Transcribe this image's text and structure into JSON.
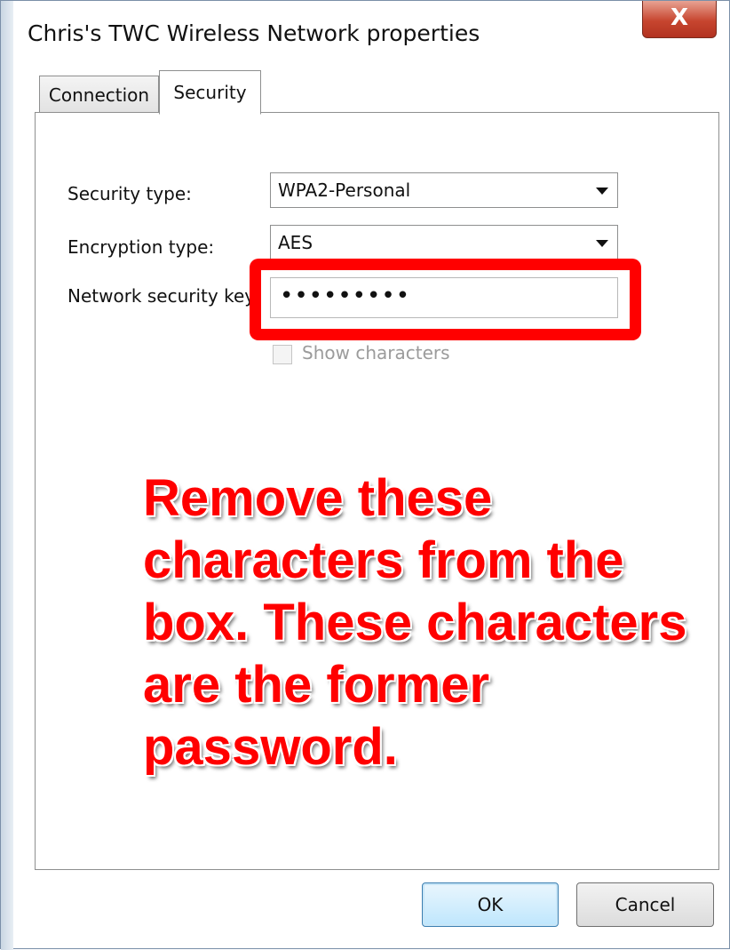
{
  "window": {
    "title": "Chris's TWC Wireless Network properties",
    "close_glyph": "X"
  },
  "tabs": [
    {
      "label": "Connection",
      "active": false
    },
    {
      "label": "Security",
      "active": true
    }
  ],
  "security": {
    "security_type_label": "Security type:",
    "security_type_value": "WPA2-Personal",
    "encryption_type_label": "Encryption type:",
    "encryption_type_value": "AES",
    "network_key_label": "Network security key",
    "network_key_value": "•••••••••",
    "show_characters_label": "Show characters",
    "show_characters_checked": false
  },
  "annotation": {
    "text": "Remove these characters from the box. These characters are the former password.",
    "color": "#ff0000"
  },
  "buttons": {
    "ok": "OK",
    "cancel": "Cancel"
  },
  "icons": {
    "close": "close-icon",
    "dropdown": "chevron-down-icon"
  }
}
